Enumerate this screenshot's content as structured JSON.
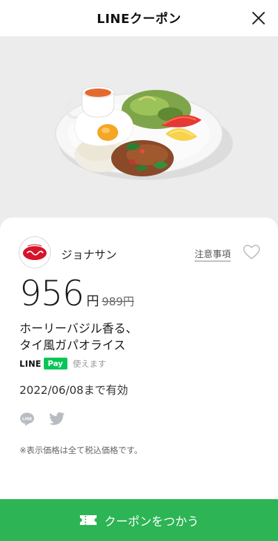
{
  "header": {
    "title": "LINEクーポン",
    "close_icon": "close-icon"
  },
  "hero": {
    "image": "food-photo-gapao-rice"
  },
  "store": {
    "name": "ジョナサン",
    "logo_icon": "jonathan-logo",
    "notes_label": "注意事項",
    "favorite_icon": "heart-icon"
  },
  "price": {
    "discounted": "956",
    "currency": "円",
    "original": "989円"
  },
  "item": {
    "line1": "ホーリーバジル香る、",
    "line2": "タイ風ガパオライス"
  },
  "payment": {
    "brand": "LINE",
    "badge": "Pay",
    "usable": "使えます"
  },
  "validity": "2022/06/08まで有効",
  "share": {
    "line_icon": "line-share-icon",
    "twitter_icon": "twitter-icon"
  },
  "tax_note": "※表示価格は全て税込価格です。",
  "cta": {
    "label": "クーポンをつかう",
    "icon": "ticket-icon"
  },
  "colors": {
    "accent_green": "#2db454",
    "pay_green": "#06c755",
    "background": "#ececec"
  }
}
